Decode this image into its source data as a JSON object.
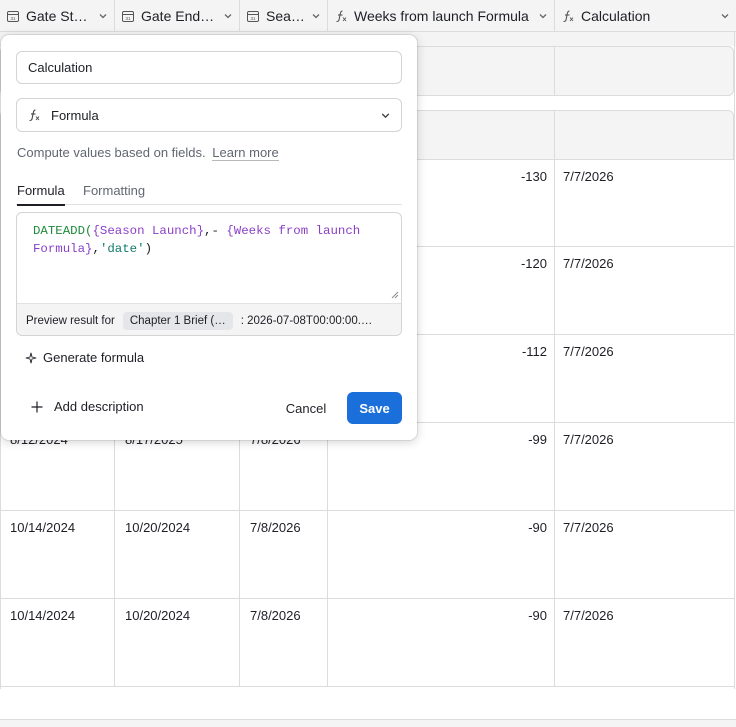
{
  "header": {
    "columns": [
      {
        "label": "Gate Sta…",
        "icon": "calendar-icon"
      },
      {
        "label": "Gate End …",
        "icon": "calendar-icon"
      },
      {
        "label": "Sea…",
        "icon": "calendar-icon"
      },
      {
        "label": "Weeks from launch Formula",
        "icon": "formula-icon"
      },
      {
        "label": "Calculation",
        "icon": "formula-icon"
      }
    ]
  },
  "rows": [
    {
      "gate_start": "",
      "gate_end": "",
      "season": "",
      "weeks": "-130",
      "calc": "7/7/2026"
    },
    {
      "gate_start": "",
      "gate_end": "",
      "season": "",
      "weeks": "-120",
      "calc": "7/7/2026"
    },
    {
      "gate_start": "",
      "gate_end": "",
      "season": "",
      "weeks": "-112",
      "calc": "7/7/2026"
    },
    {
      "gate_start": "8/12/2024",
      "gate_end": "8/17/2025",
      "season": "7/8/2026",
      "weeks": "-99",
      "calc": "7/7/2026"
    },
    {
      "gate_start": "10/14/2024",
      "gate_end": "10/20/2024",
      "season": "7/8/2026",
      "weeks": "-90",
      "calc": "7/7/2026"
    },
    {
      "gate_start": "10/14/2024",
      "gate_end": "10/20/2024",
      "season": "7/8/2026",
      "weeks": "-90",
      "calc": "7/7/2026"
    }
  ],
  "popover": {
    "field_name": "Calculation",
    "field_type": "Formula",
    "description": "Compute values based on fields.",
    "learn_more": "Learn more",
    "tabs": [
      "Formula",
      "Formatting"
    ],
    "formula": {
      "fn": "DATEADD(",
      "field1": "{Season Launch}",
      "sep": ",- ",
      "field2_line1": "{Weeks from launch",
      "field2_line2": "Formula}",
      "comma": ",",
      "str": "'date'",
      "close": ")"
    },
    "preview_label": "Preview result for",
    "preview_record": "Chapter 1 Brief (…",
    "preview_value": ": 2026-07-08T00:00:00.…",
    "generate_label": "Generate formula",
    "add_description_label": "Add description",
    "cancel_label": "Cancel",
    "save_label": "Save"
  },
  "colors": {
    "accent": "#1b6fdb",
    "fn": "#1f8a3b",
    "field": "#8a3fc7",
    "string": "#0f7a6c"
  }
}
